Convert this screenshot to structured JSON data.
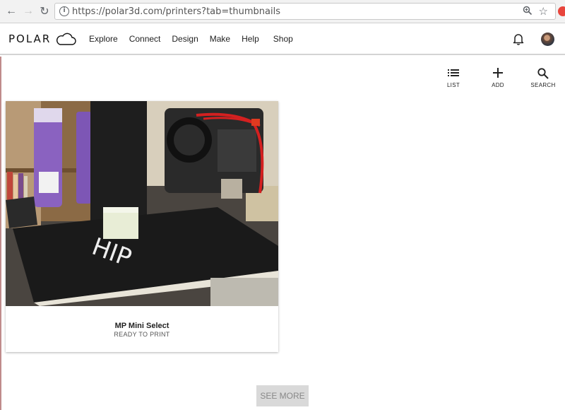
{
  "browser": {
    "url": "https://polar3d.com/printers?tab=thumbnails",
    "info_glyph": "i"
  },
  "header": {
    "logo_text": "POLAR",
    "nav": [
      "Explore",
      "Connect",
      "Design",
      "Make",
      "Help",
      "Shop"
    ]
  },
  "toolbar": {
    "list_label": "LIST",
    "add_label": "ADD",
    "search_label": "SEARCH"
  },
  "printers": [
    {
      "name": "MP Mini Select",
      "status": "READY TO PRINT"
    }
  ],
  "see_more_label": "SEE MORE",
  "icons": {
    "back": "arrow-left-icon",
    "forward": "arrow-right-icon",
    "reload": "reload-icon",
    "zoom": "zoom-icon",
    "bookmark": "star-icon",
    "bell": "bell-icon"
  }
}
